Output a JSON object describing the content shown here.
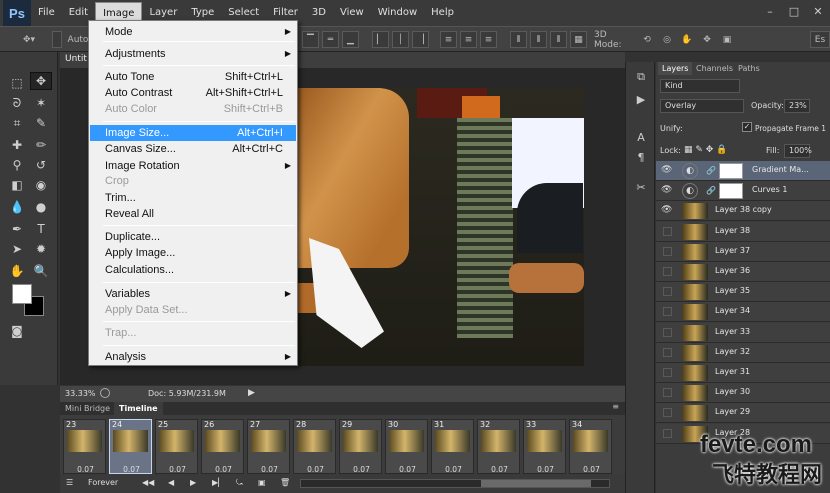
{
  "app": {
    "logo": "Ps"
  },
  "menubar": {
    "items": [
      "File",
      "Edit",
      "Image",
      "Layer",
      "Type",
      "Select",
      "Filter",
      "3D",
      "View",
      "Window",
      "Help"
    ],
    "active": "Image"
  },
  "window_controls": {
    "minimize": "–",
    "maximize": "□",
    "close": "✕"
  },
  "options_bar": {
    "auto_label": "Auto",
    "mode_label": "3D Mode:",
    "workspace": "Es"
  },
  "document": {
    "tab_title": "Untit",
    "zoom": "33.33%",
    "doc_size": "Doc: 5.93M/231.9M"
  },
  "image_menu": {
    "items": [
      {
        "label": "Mode",
        "shortcut": "",
        "submenu": true,
        "disabled": false
      },
      {
        "label": "Adjustments",
        "shortcut": "",
        "submenu": true,
        "disabled": false
      },
      {
        "label": "Auto Tone",
        "shortcut": "Shift+Ctrl+L",
        "submenu": false,
        "disabled": false
      },
      {
        "label": "Auto Contrast",
        "shortcut": "Alt+Shift+Ctrl+L",
        "submenu": false,
        "disabled": false
      },
      {
        "label": "Auto Color",
        "shortcut": "Shift+Ctrl+B",
        "submenu": false,
        "disabled": true
      },
      {
        "label": "Image Size...",
        "shortcut": "Alt+Ctrl+I",
        "submenu": false,
        "disabled": false,
        "highlighted": true
      },
      {
        "label": "Canvas Size...",
        "shortcut": "Alt+Ctrl+C",
        "submenu": false,
        "disabled": false
      },
      {
        "label": "Image Rotation",
        "shortcut": "",
        "submenu": true,
        "disabled": false
      },
      {
        "label": "Crop",
        "shortcut": "",
        "submenu": false,
        "disabled": true
      },
      {
        "label": "Trim...",
        "shortcut": "",
        "submenu": false,
        "disabled": false
      },
      {
        "label": "Reveal All",
        "shortcut": "",
        "submenu": false,
        "disabled": false
      },
      {
        "label": "Duplicate...",
        "shortcut": "",
        "submenu": false,
        "disabled": false
      },
      {
        "label": "Apply Image...",
        "shortcut": "",
        "submenu": false,
        "disabled": false
      },
      {
        "label": "Calculations...",
        "shortcut": "",
        "submenu": false,
        "disabled": false
      },
      {
        "label": "Variables",
        "shortcut": "",
        "submenu": true,
        "disabled": false
      },
      {
        "label": "Apply Data Set...",
        "shortcut": "",
        "submenu": false,
        "disabled": true
      },
      {
        "label": "Trap...",
        "shortcut": "",
        "submenu": false,
        "disabled": true
      },
      {
        "label": "Analysis",
        "shortcut": "",
        "submenu": true,
        "disabled": false
      }
    ]
  },
  "timeline": {
    "tabs": [
      "Mini Bridge",
      "Timeline"
    ],
    "active_tab": "Timeline",
    "frames": [
      {
        "num": "23",
        "delay": "0.07"
      },
      {
        "num": "24",
        "delay": "0.07",
        "selected": true
      },
      {
        "num": "25",
        "delay": "0.07"
      },
      {
        "num": "26",
        "delay": "0.07"
      },
      {
        "num": "27",
        "delay": "0.07"
      },
      {
        "num": "28",
        "delay": "0.07"
      },
      {
        "num": "29",
        "delay": "0.07"
      },
      {
        "num": "30",
        "delay": "0.07"
      },
      {
        "num": "31",
        "delay": "0.07"
      },
      {
        "num": "32",
        "delay": "0.07"
      },
      {
        "num": "33",
        "delay": "0.07"
      },
      {
        "num": "34",
        "delay": "0.07"
      }
    ],
    "loop": "Forever"
  },
  "layers_panel": {
    "tabs": [
      "Layers",
      "Channels",
      "Paths"
    ],
    "active_tab": "Layers",
    "filter": "Kind",
    "blend_mode": "Overlay",
    "opacity_label": "Opacity:",
    "opacity": "23%",
    "unify_label": "Unify:",
    "propagate_label": "Propagate Frame 1",
    "lock_label": "Lock:",
    "fill_label": "Fill:",
    "fill": "100%",
    "layers": [
      {
        "name": "Gradient Ma...",
        "type": "adjustment",
        "visible": true,
        "selected": true
      },
      {
        "name": "Curves 1",
        "type": "adjustment",
        "visible": true
      },
      {
        "name": "Layer 38 copy",
        "type": "pixel",
        "visible": true
      },
      {
        "name": "Layer 38",
        "type": "pixel",
        "visible": false
      },
      {
        "name": "Layer 37",
        "type": "pixel",
        "visible": false
      },
      {
        "name": "Layer 36",
        "type": "pixel",
        "visible": false
      },
      {
        "name": "Layer 35",
        "type": "pixel",
        "visible": false
      },
      {
        "name": "Layer 34",
        "type": "pixel",
        "visible": false
      },
      {
        "name": "Layer 33",
        "type": "pixel",
        "visible": false
      },
      {
        "name": "Layer 32",
        "type": "pixel",
        "visible": false
      },
      {
        "name": "Layer 31",
        "type": "pixel",
        "visible": false
      },
      {
        "name": "Layer 30",
        "type": "pixel",
        "visible": false
      },
      {
        "name": "Layer 29",
        "type": "pixel",
        "visible": false
      },
      {
        "name": "Layer 28",
        "type": "pixel",
        "visible": false
      }
    ]
  },
  "watermark": {
    "line1": "fevte.com",
    "line2": "飞特教程网"
  },
  "colors": {
    "menu_highlight": "#3399ff",
    "selected_layer": "#5a6577",
    "app_bg": "#323232"
  }
}
